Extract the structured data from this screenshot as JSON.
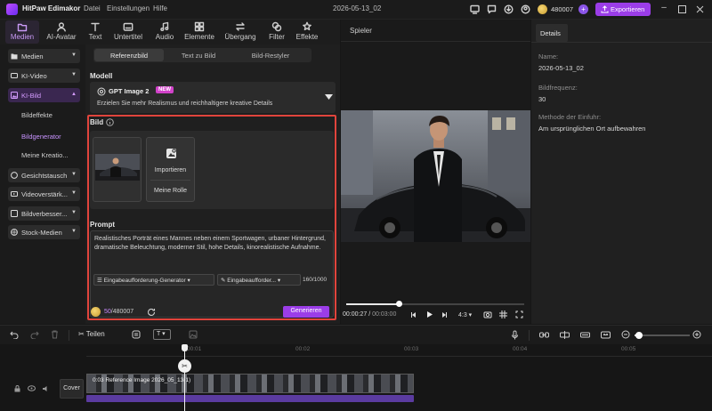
{
  "app": {
    "title": "HitPaw Edimakor",
    "menu": [
      "Datei",
      "Einstellungen",
      "Hilfe"
    ],
    "project": "2026-05-13_02",
    "credits": "480007",
    "export_label": "Exportieren"
  },
  "toolbar": {
    "items": [
      {
        "label": "Medien",
        "icon": "media-icon"
      },
      {
        "label": "AI-Avatar",
        "icon": "avatar-icon"
      },
      {
        "label": "Text",
        "icon": "text-icon"
      },
      {
        "label": "Untertitel",
        "icon": "subtitle-icon"
      },
      {
        "label": "Audio",
        "icon": "audio-icon"
      },
      {
        "label": "Elemente",
        "icon": "elements-icon"
      },
      {
        "label": "Übergang",
        "icon": "transition-icon"
      },
      {
        "label": "Filter",
        "icon": "filter-icon"
      },
      {
        "label": "Effekte",
        "icon": "effects-icon"
      }
    ]
  },
  "sidebar": {
    "items": [
      {
        "label": "Medien"
      },
      {
        "label": "KI-Video"
      },
      {
        "label": "KI-Bild"
      }
    ],
    "sub": [
      "Bildeffekte",
      "Bildgenerator",
      "Meine Kreatio..."
    ],
    "items2": [
      {
        "label": "Gesichtstausch"
      },
      {
        "label": "Videoverstärk..."
      },
      {
        "label": "Bildverbesser..."
      },
      {
        "label": "Stock-Medien"
      }
    ]
  },
  "main": {
    "tabs": [
      "Referenzbild",
      "Text zu Bild",
      "Bild-Restyler"
    ],
    "model_heading": "Modell",
    "model_name": "GPT Image 2",
    "model_badge": "NEW",
    "model_desc": "Erzielen Sie mehr Realismus und reichhaltigere kreative Details",
    "bild_heading": "Bild",
    "import_label": "Importieren",
    "role_label": "Meine Rolle",
    "prompt_heading": "Prompt",
    "prompt_text": "Realistisches Porträt eines Mannes neben einem Sportwagen, urbaner Hintergrund, dramatische Beleuchtung, moderner Stil, hohe Details, kinorealistische Aufnahme.",
    "gen1": "Eingabeaufforderung-Generator",
    "gen2": "Eingabeaufforder...",
    "count": "160/1000",
    "cost": "50",
    "cost_total": "/480007",
    "generate": "Generieren"
  },
  "preview": {
    "title": "Spieler",
    "current": "00:00:27",
    "total": "00:03:00",
    "ratio": "4:3",
    "progress": 0.12
  },
  "details": {
    "tab": "Details",
    "name_label": "Name:",
    "name": "2026-05-13_02",
    "fps_label": "Bildfrequenz:",
    "fps": "30",
    "method_label": "Methode der Einfuhr:",
    "method": "Am ursprünglichen Ort aufbewahren"
  },
  "timeline": {
    "split": "Teilen",
    "ticks": [
      "00:01",
      "00:02",
      "00:03",
      "00:04",
      "00:05"
    ],
    "cover": "Cover",
    "clip": "0:03 Reference Image 2026_05_13(1)"
  },
  "colors": {
    "accent": "#9b3de8",
    "highlight": "#e0443c"
  }
}
